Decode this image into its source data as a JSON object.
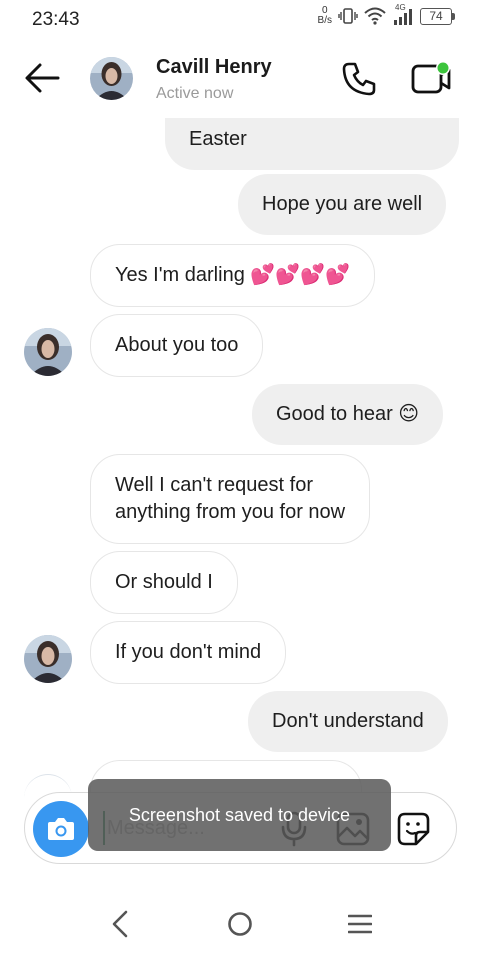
{
  "status_bar": {
    "time": "23:43",
    "net_speed_value": "0",
    "net_speed_unit": "B/s",
    "network_label": "4G",
    "battery": "74"
  },
  "header": {
    "contact_name": "Cavill Henry",
    "contact_status": "Active now",
    "icons": [
      "back-arrow-icon",
      "phone-icon",
      "video-call-icon"
    ],
    "online_dot_color": "#3cc43c"
  },
  "messages": [
    {
      "direction": "out",
      "text": "Easter"
    },
    {
      "direction": "out",
      "text": "Hope you are well"
    },
    {
      "direction": "in",
      "text": "Yes I'm darling 💕💕💕💕"
    },
    {
      "direction": "in",
      "text": "About you too"
    },
    {
      "direction": "out",
      "text": "Good to hear 😊"
    },
    {
      "direction": "in",
      "text_line1": "Well I can't request for",
      "text_line2": "anything from you for now"
    },
    {
      "direction": "in",
      "text": "Or should I"
    },
    {
      "direction": "in",
      "text": "If you don't mind"
    },
    {
      "direction": "out",
      "text": "Don't understand"
    }
  ],
  "composer": {
    "placeholder": "Message...",
    "accent_color": "#3897f0",
    "icons": [
      "camera-icon",
      "microphone-icon",
      "gallery-icon",
      "sticker-icon"
    ]
  },
  "toast": {
    "text": "Screenshot saved to device"
  },
  "nav_bar": {
    "icons": [
      "nav-back-icon",
      "nav-home-icon",
      "nav-menu-icon"
    ]
  }
}
